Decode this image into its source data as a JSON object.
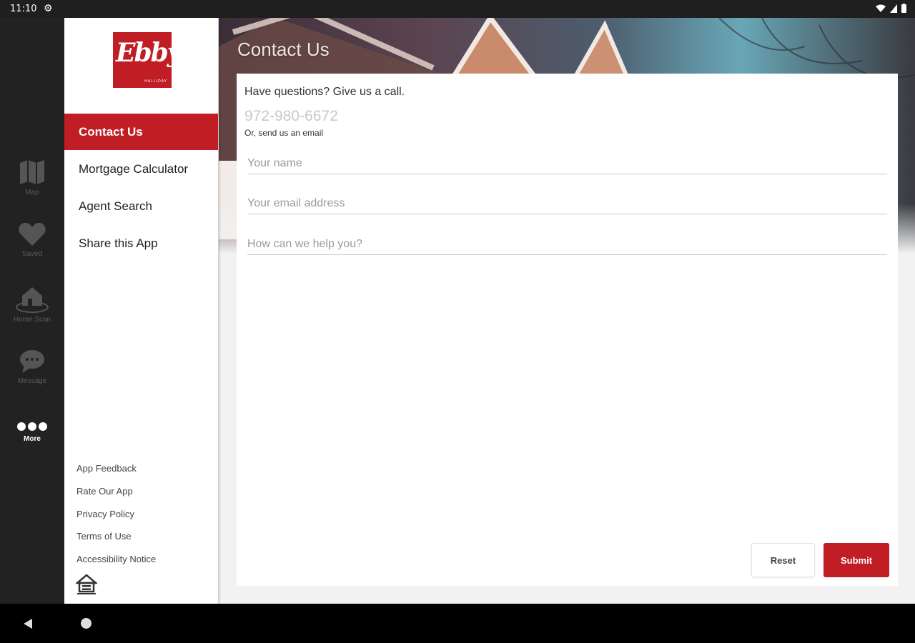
{
  "status": {
    "time": "11:10"
  },
  "rail": {
    "items": [
      {
        "label": "Map",
        "icon": "map-icon"
      },
      {
        "label": "Saved",
        "icon": "heart-icon"
      },
      {
        "label": "Home Scan",
        "icon": "home-scan-icon"
      },
      {
        "label": "Message",
        "icon": "chat-icon"
      },
      {
        "label": "More",
        "icon": "more-icon"
      }
    ]
  },
  "header": {
    "title": "Contact Us"
  },
  "drawer": {
    "logo": {
      "text": "Ebby",
      "subtext": "HALLIDAY"
    },
    "menu": [
      "Contact Us",
      "Mortgage Calculator",
      "Agent Search",
      "Share this App"
    ],
    "footer_links": [
      "App Feedback",
      "Rate Our App",
      "Privacy Policy",
      "Terms of Use",
      "Accessibility Notice"
    ]
  },
  "contact": {
    "question": "Have questions? Give us a call.",
    "phone": "972-980-6672",
    "or_email": "Or, send us an email",
    "fields": {
      "name_placeholder": "Your name",
      "email_placeholder": "Your email address",
      "message_placeholder": "How can we help you?"
    },
    "reset_label": "Reset",
    "submit_label": "Submit"
  },
  "colors": {
    "accent": "#c01d25",
    "rail_bg": "#222222"
  }
}
